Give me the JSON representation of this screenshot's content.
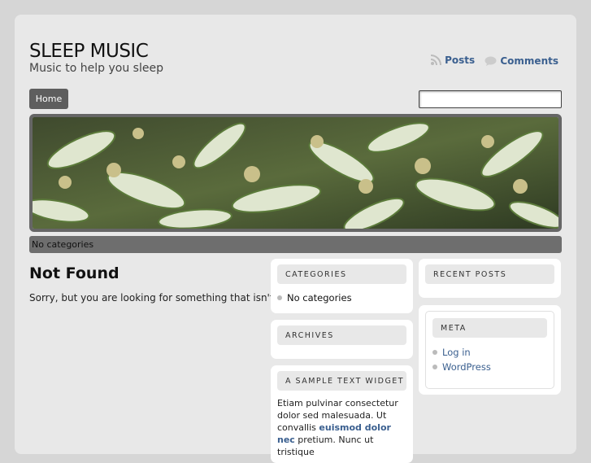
{
  "header": {
    "title": "SLEEP MUSIC",
    "description": "Music to help you sleep",
    "feeds": {
      "posts": "Posts",
      "comments": "Comments"
    }
  },
  "nav": {
    "home": "Home"
  },
  "search": {
    "value": ""
  },
  "category_bar": "No categories",
  "main": {
    "title": "Not Found",
    "text": "Sorry, but you are looking for something that isn't here."
  },
  "sidebar1": {
    "categories": {
      "heading": "CATEGORIES",
      "items": [
        "No categories"
      ]
    },
    "archives": {
      "heading": "ARCHIVES"
    },
    "text_widget": {
      "heading": "A SAMPLE TEXT WIDGET",
      "text_before": "Etiam pulvinar consectetur dolor sed malesuada. Ut convallis ",
      "link": "euismod dolor nec",
      "text_after": " pretium. Nunc ut tristique"
    }
  },
  "sidebar2": {
    "recent": {
      "heading": "RECENT POSTS"
    },
    "meta": {
      "heading": "META",
      "items": [
        "Log in",
        "WordPress"
      ]
    }
  },
  "colors": {
    "link": "#3a5f8f",
    "nav_bg": "#5e5e5e",
    "page_bg": "#e8e8e8",
    "outer_bg": "#d6d6d6"
  }
}
